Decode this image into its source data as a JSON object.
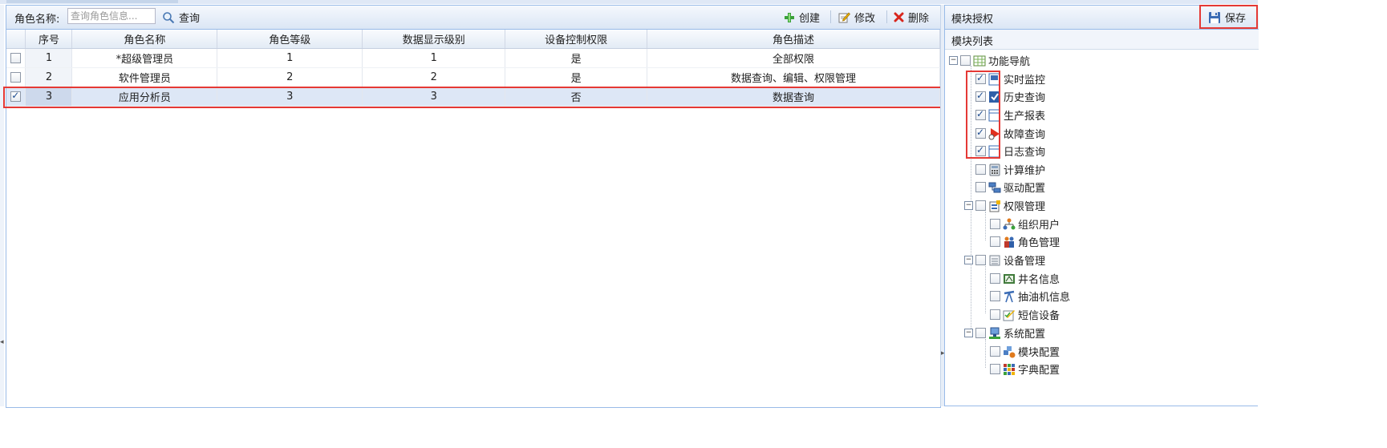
{
  "toolbar": {
    "role_name_label": "角色名称:",
    "search_placeholder": "查询角色信息...",
    "query_label": "查询",
    "create_label": "创建",
    "edit_label": "修改",
    "delete_label": "删除"
  },
  "grid": {
    "columns": [
      "序号",
      "角色名称",
      "角色等级",
      "数据显示级别",
      "设备控制权限",
      "角色描述"
    ],
    "rows": [
      {
        "no": "1",
        "name": "*超级管理员",
        "level": "1",
        "display_level": "1",
        "device_control": "是",
        "description": "全部权限",
        "checked": false
      },
      {
        "no": "2",
        "name": "软件管理员",
        "level": "2",
        "display_level": "2",
        "device_control": "是",
        "description": "数据查询、编辑、权限管理",
        "checked": false
      },
      {
        "no": "3",
        "name": "应用分析员",
        "level": "3",
        "display_level": "3",
        "device_control": "否",
        "description": "数据查询",
        "checked": true
      }
    ]
  },
  "right_panel": {
    "title": "模块授权",
    "save_label": "保存",
    "list_title": "模块列表",
    "tree": {
      "root": "功能导航",
      "items": [
        {
          "label": "实时监控",
          "checked": true,
          "icon": "monitor-icon"
        },
        {
          "label": "历史查询",
          "checked": true,
          "icon": "history-icon"
        },
        {
          "label": "生产报表",
          "checked": true,
          "icon": "report-icon"
        },
        {
          "label": "故障查询",
          "checked": true,
          "icon": "fault-icon"
        },
        {
          "label": "日志查询",
          "checked": true,
          "icon": "log-icon"
        },
        {
          "label": "计算维护",
          "checked": false,
          "icon": "calculator-icon"
        },
        {
          "label": "驱动配置",
          "checked": false,
          "icon": "driver-icon"
        }
      ],
      "groups": [
        {
          "label": "权限管理",
          "icon": "permission-icon",
          "children": [
            {
              "label": "组织用户",
              "icon": "org-icon"
            },
            {
              "label": "角色管理",
              "icon": "role-icon"
            }
          ]
        },
        {
          "label": "设备管理",
          "icon": "device-icon",
          "children": [
            {
              "label": "井名信息",
              "icon": "well-icon"
            },
            {
              "label": "抽油机信息",
              "icon": "pump-icon"
            },
            {
              "label": "短信设备",
              "icon": "sms-icon"
            }
          ]
        },
        {
          "label": "系统配置",
          "icon": "system-icon",
          "children": [
            {
              "label": "模块配置",
              "icon": "module-icon"
            },
            {
              "label": "字典配置",
              "icon": "dictionary-icon"
            }
          ]
        }
      ]
    }
  },
  "colors": {
    "highlight": "#e53935",
    "header_blue": "#dbe6f5",
    "selected_row": "#dde7f6"
  }
}
